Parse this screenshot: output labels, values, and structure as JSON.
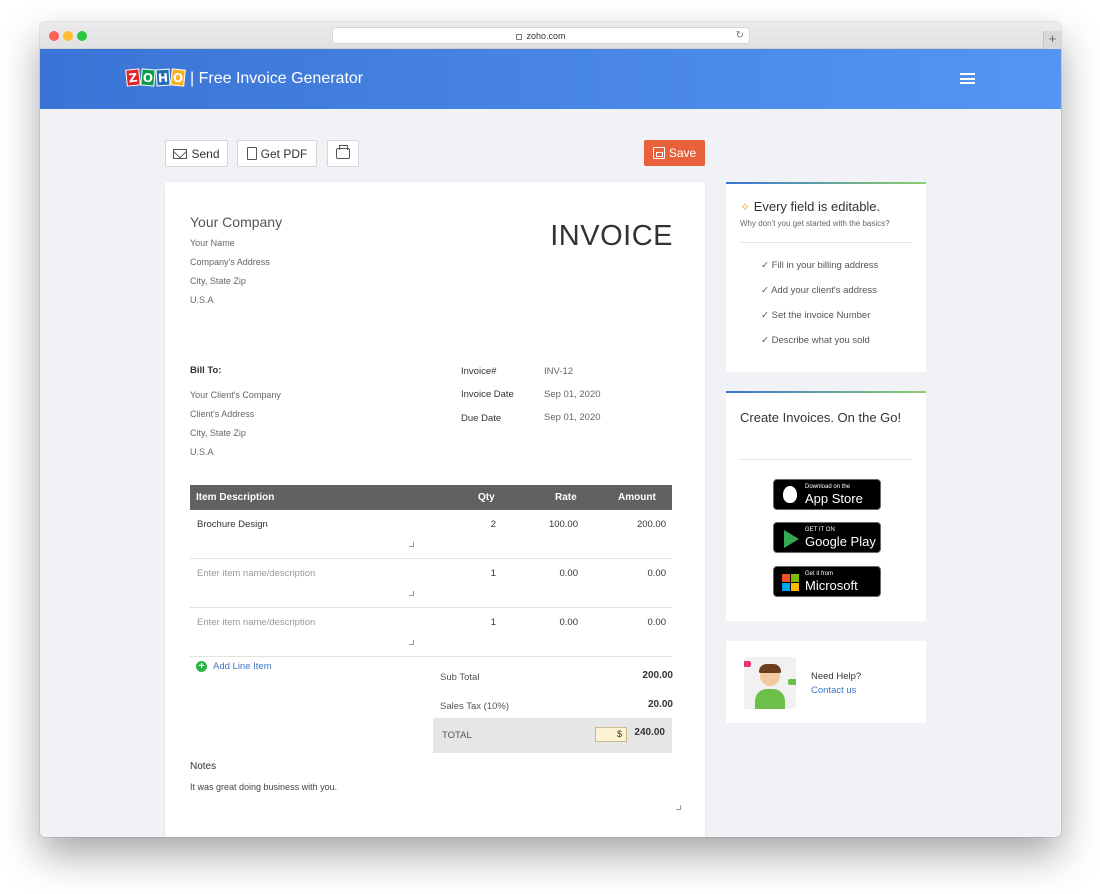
{
  "browser": {
    "url": "zoho.com"
  },
  "header": {
    "logo_letters": [
      "Z",
      "O",
      "H",
      "O"
    ],
    "title": "| Free Invoice Generator"
  },
  "toolbar": {
    "send_label": "Send",
    "pdf_label": "Get PDF",
    "save_label": "Save"
  },
  "invoice": {
    "company_name": "Your Company",
    "your_name": "Your Name",
    "company_address": "Company's Address",
    "city_state_zip": "City, State Zip",
    "country": "U.S.A",
    "title": "INVOICE",
    "bill_to_label": "Bill To:",
    "client_company": "Your Client's Company",
    "client_address": "Client's Address",
    "client_city": "City, State Zip",
    "client_country": "U.S.A",
    "invoice_no_label": "Invoice#",
    "invoice_no": "INV-12",
    "invoice_date_label": "Invoice Date",
    "invoice_date": "Sep 01, 2020",
    "due_date_label": "Due Date",
    "due_date": "Sep 01, 2020",
    "columns": {
      "description": "Item Description",
      "qty": "Qty",
      "rate": "Rate",
      "amount": "Amount"
    },
    "items": [
      {
        "description": "Brochure Design",
        "qty": "2",
        "rate": "100.00",
        "amount": "200.00"
      },
      {
        "placeholder": "Enter item name/description",
        "qty": "1",
        "rate": "0.00",
        "amount": "0.00"
      },
      {
        "placeholder": "Enter item name/description",
        "qty": "1",
        "rate": "0.00",
        "amount": "0.00"
      }
    ],
    "add_line_label": "Add Line Item",
    "sub_total_label": "Sub Total",
    "sub_total": "200.00",
    "tax_label": "Sales Tax (10%)",
    "tax": "20.00",
    "total_label": "TOTAL",
    "currency": "$",
    "total": "240.00",
    "notes_label": "Notes",
    "notes": "It was great doing business with you."
  },
  "tips": {
    "title_prefix": "Every field is ",
    "title_emph": "editable.",
    "subtitle": "Why don't you get started with the basics?",
    "items": [
      "Fill in your billing address",
      "Add your client's address",
      "Set the invoice Number",
      "Describe what you sold"
    ]
  },
  "apps": {
    "title_bold": "Create Invoices.",
    "title_rest": " On the Go!",
    "app_store_small": "Download on the",
    "app_store_big": "App Store",
    "google_small": "GET IT ON",
    "google_big": "Google Play",
    "ms_small": "Get it from",
    "ms_big": "Microsoft"
  },
  "help": {
    "title": "Need Help?",
    "link": "Contact us"
  }
}
